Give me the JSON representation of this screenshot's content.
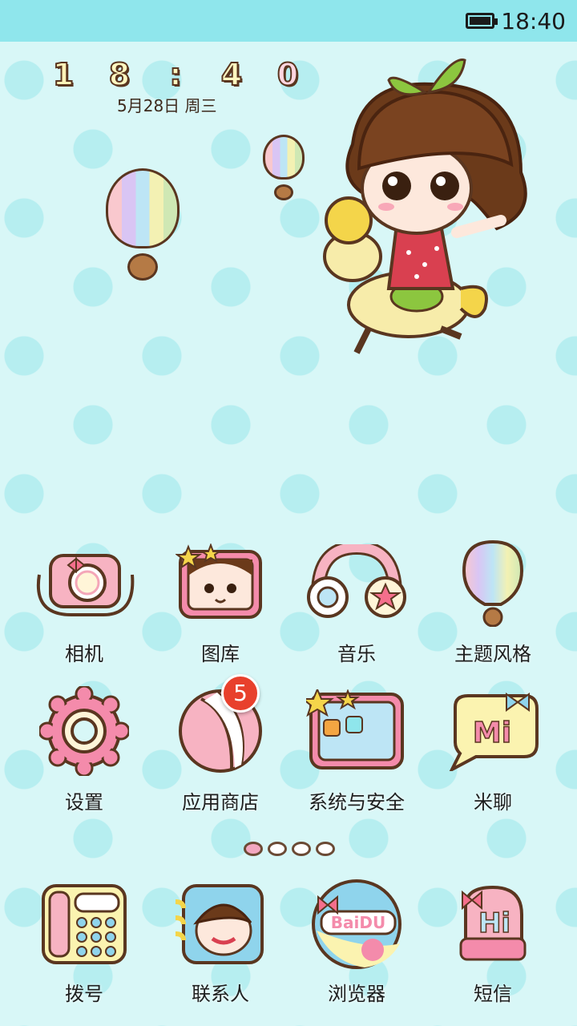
{
  "status_bar": {
    "time": "18:40",
    "battery_icon": "battery-icon"
  },
  "clock_widget": {
    "digits": [
      "1",
      "8",
      ":",
      "4",
      "0"
    ],
    "date": "5月28日 周三"
  },
  "apps": [
    {
      "label": "相机",
      "icon": "camera-icon"
    },
    {
      "label": "图库",
      "icon": "gallery-icon"
    },
    {
      "label": "音乐",
      "icon": "headphones-icon"
    },
    {
      "label": "主题风格",
      "icon": "balloon-theme-icon"
    },
    {
      "label": "设置",
      "icon": "gear-icon"
    },
    {
      "label": "应用商店",
      "icon": "ball-store-icon",
      "badge": "5"
    },
    {
      "label": "系统与安全",
      "icon": "security-icon"
    },
    {
      "label": "米聊",
      "icon": "mi-chat-icon"
    }
  ],
  "page_indicator": {
    "count": 4,
    "active": 0
  },
  "dock": [
    {
      "label": "拨号",
      "icon": "phone-icon"
    },
    {
      "label": "联系人",
      "icon": "contacts-icon"
    },
    {
      "label": "浏览器",
      "icon": "browser-icon",
      "logo_text": "BaiDU"
    },
    {
      "label": "短信",
      "icon": "message-icon",
      "logo_text": "Hi"
    }
  ],
  "colors": {
    "status_bar": "#8fe6ec",
    "background": "#d8f7f7",
    "dots": "#b6eef0",
    "badge": "#e8402c"
  }
}
